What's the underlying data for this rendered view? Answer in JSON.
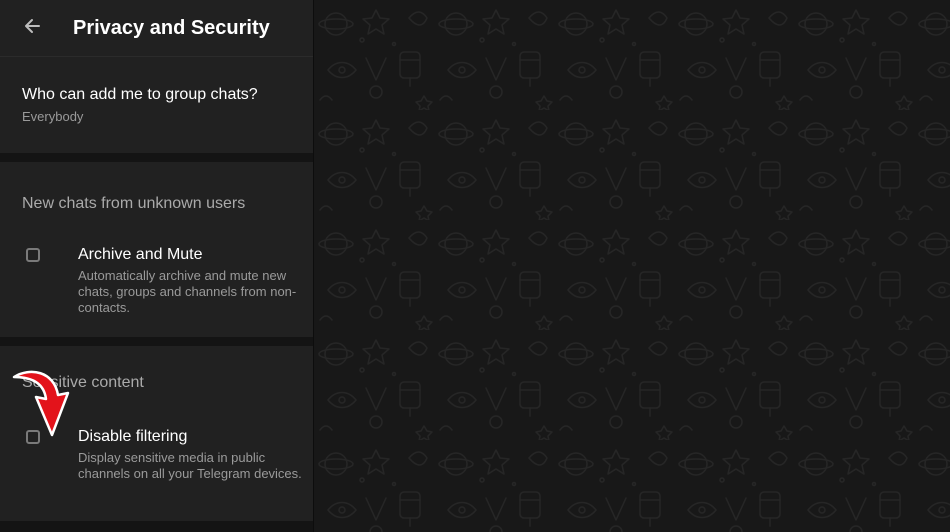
{
  "header": {
    "title": "Privacy and Security",
    "back_icon": "arrow-left-icon"
  },
  "group_chats": {
    "title": "Who can add me to group chats?",
    "value": "Everybody"
  },
  "unknown_users": {
    "section_label": "New chats from unknown users",
    "option": {
      "title": "Archive and Mute",
      "description": "Automatically archive and mute new chats, groups and channels from non-contacts.",
      "checked": false
    }
  },
  "sensitive": {
    "section_label": "Sensitive content",
    "option": {
      "title": "Disable filtering",
      "description": "Display sensitive media in public channels on all your Telegram devices.",
      "checked": false
    }
  },
  "colors": {
    "panel_bg": "#212121",
    "app_bg": "#141414",
    "chat_bg": "#181818",
    "annotation_arrow": "#e3131b"
  }
}
